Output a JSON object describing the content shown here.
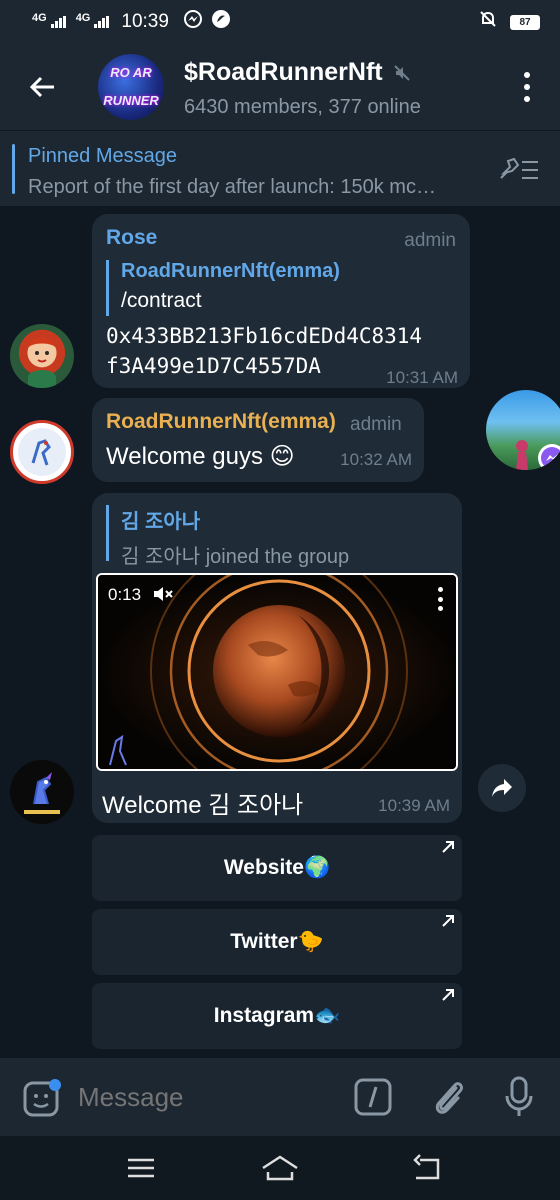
{
  "status_bar": {
    "network1": "4G",
    "network2": "4G",
    "time": "10:39",
    "battery": "87"
  },
  "header": {
    "back_icon": "arrow-left-icon",
    "title": "$RoadRunnerNft",
    "muted_icon": "muted-speaker-icon",
    "subtitle": "6430 members, 377 online",
    "avatar_text_top": "RO AR",
    "avatar_text_bottom": "RUNNER",
    "menu_icon": "kebab-menu-icon"
  },
  "pinned": {
    "title": "Pinned Message",
    "text": "Report of the first day after launch: 150k mc…"
  },
  "messages": [
    {
      "sender": "Rose",
      "role": "admin",
      "sender_color": "#62a8e8",
      "quote_sender": "RoadRunnerNft(emma)",
      "quote_text": "/contract",
      "line1": "0x433BB213Fb16cdEDd4C8314",
      "line2": "f3A499e1D7C4557DA",
      "time": "10:31 AM"
    },
    {
      "sender": "RoadRunnerNft(emma)",
      "role": "admin",
      "sender_color": "#e8b050",
      "text": "Welcome guys 😊",
      "time": "10:32 AM"
    },
    {
      "quote_sender": "김 조아나",
      "quote_text": "김 조아나 joined the group",
      "video_duration": "0:13",
      "text": "Welcome 김 조아나",
      "time": "10:39 AM"
    }
  ],
  "keyboard_buttons": [
    {
      "label": "Website🌍"
    },
    {
      "label": "Twitter🐤"
    },
    {
      "label": "Instagram🐟"
    }
  ],
  "input": {
    "placeholder": "Message"
  },
  "colors": {
    "accent": "#62a8e8",
    "header_bg": "#1c2731",
    "chat_bg": "#0f1820",
    "bubble_bg": "#1f2b36"
  }
}
